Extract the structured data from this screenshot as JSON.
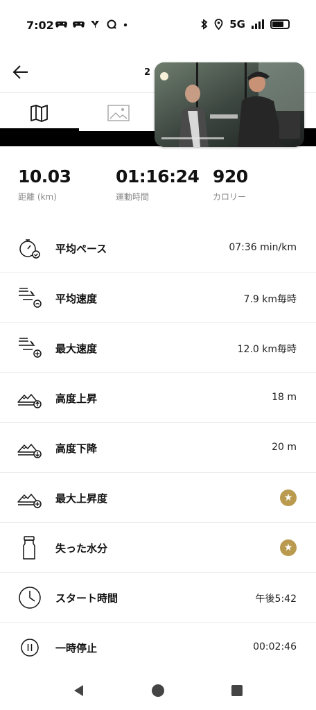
{
  "status_bar": {
    "time": "7:02",
    "left_icons": [
      "game-controller-icon",
      "game-controller-icon",
      "yahoo-icon",
      "chat-icon",
      "dot-icon"
    ],
    "network": "5G",
    "right_icons": [
      "bluetooth-icon",
      "location-icon",
      "signal-icon",
      "battery-icon"
    ]
  },
  "header": {
    "title": "2"
  },
  "tabs": [
    {
      "name": "map",
      "icon": "map-icon"
    },
    {
      "name": "photo",
      "icon": "image-icon"
    }
  ],
  "summary": [
    {
      "value": "10.03",
      "label": "距離 (km)"
    },
    {
      "value": "01:16:24",
      "label": "運動時間"
    },
    {
      "value": "920",
      "label": "カロリー"
    }
  ],
  "metrics": [
    {
      "label": "平均ペース",
      "value": "07:36 min/km",
      "icon": "pace-stopwatch-icon"
    },
    {
      "label": "平均速度",
      "value": "7.9 km毎時",
      "icon": "speed-average-icon"
    },
    {
      "label": "最大速度",
      "value": "12.0 km毎時",
      "icon": "speed-max-icon"
    },
    {
      "label": "高度上昇",
      "value": "18 m",
      "icon": "elevation-up-icon"
    },
    {
      "label": "高度下降",
      "value": "20 m",
      "icon": "elevation-down-icon"
    },
    {
      "label": "最大上昇度",
      "value": "",
      "icon": "elevation-max-icon",
      "premium": true
    },
    {
      "label": "失った水分",
      "value": "",
      "icon": "water-bottle-icon",
      "premium": true
    },
    {
      "label": "スタート時間",
      "value": "午後5:42",
      "icon": "clock-icon"
    },
    {
      "label": "一時停止",
      "value": "00:02:46",
      "icon": "pause-icon"
    }
  ],
  "colors": {
    "premium_gold": "#b99a4f",
    "band": "#000000"
  }
}
